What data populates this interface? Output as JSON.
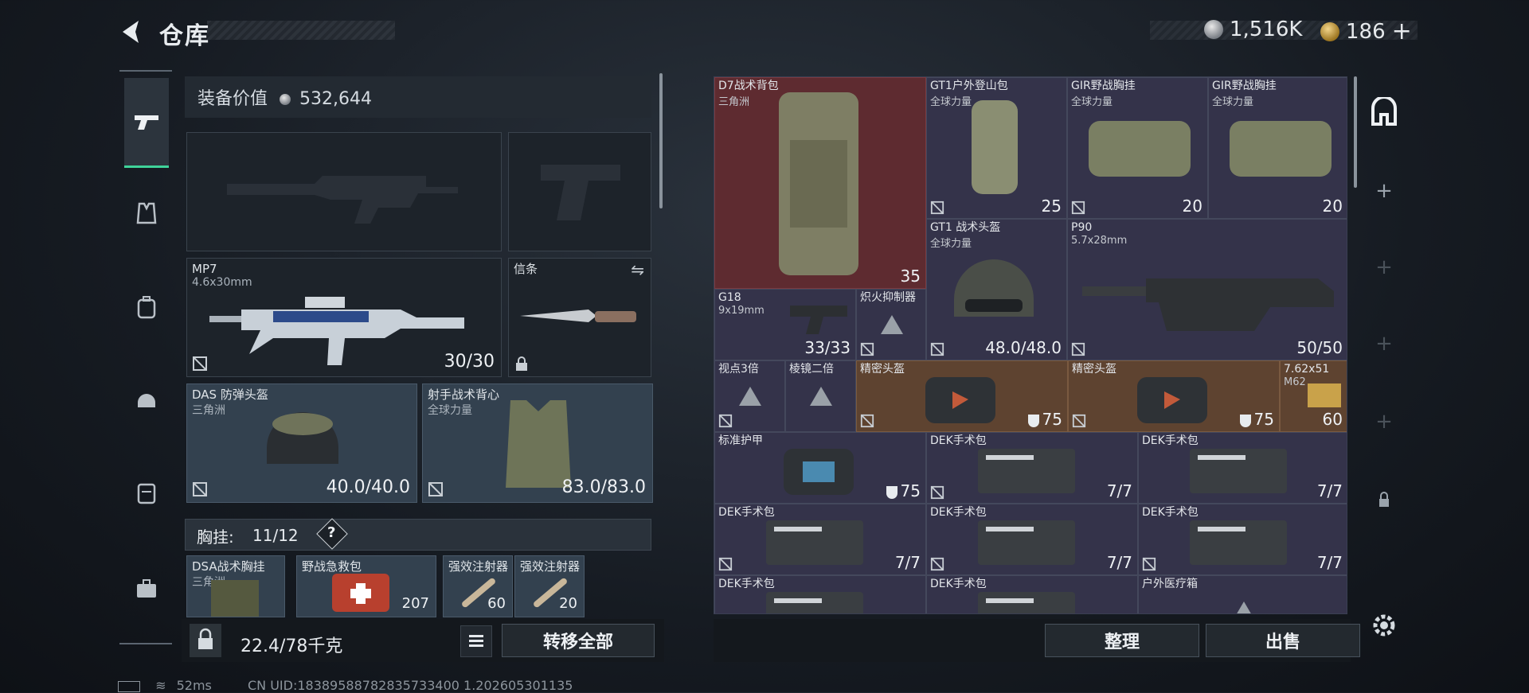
{
  "header": {
    "title": "仓库",
    "currency_silver": "1,516K",
    "currency_gold": "186",
    "add_label": "+"
  },
  "left": {
    "equip_value_label": "装备价值",
    "equip_value": "532,644",
    "slots": {
      "primary": {
        "name": "MP7",
        "sub": "4.6x30mm",
        "count": "30/30"
      },
      "melee": {
        "name": "信条",
        "swap": "⇋"
      },
      "helmet": {
        "name": "DAS 防弹头盔",
        "sub": "三角洲",
        "count": "40.0/40.0"
      },
      "armor": {
        "name": "射手战术背心",
        "sub": "全球力量",
        "count": "83.0/83.0"
      }
    },
    "vest_label": "胸挂:",
    "vest_count": "11/12",
    "vest_help": "?",
    "vest_items": [
      {
        "name": "DSA战术胸挂",
        "sub": "三角洲"
      },
      {
        "name": "野战急救包",
        "count": "207"
      },
      {
        "name": "强效注射器",
        "count": "60"
      },
      {
        "name": "强效注射器",
        "count": "20"
      }
    ],
    "weight": "22.4/78千克",
    "transfer_all": "转移全部"
  },
  "grid": {
    "items": [
      {
        "name": "D7战术背包",
        "sub": "三角洲",
        "count": "35"
      },
      {
        "name": "GT1户外登山包",
        "sub": "全球力量",
        "count": "25"
      },
      {
        "name": "GIR野战胸挂",
        "sub": "全球力量",
        "count": "20"
      },
      {
        "name": "GIR野战胸挂",
        "sub": "全球力量",
        "count": "20"
      },
      {
        "name": "GT1 战术头盔",
        "sub": "全球力量",
        "count": "48.0/48.0"
      },
      {
        "name": "P90",
        "sub": "5.7x28mm",
        "count": "50/50"
      },
      {
        "name": "G18",
        "sub": "9x19mm",
        "count": "33/33"
      },
      {
        "name": "炽火抑制器"
      },
      {
        "name": "视点3倍"
      },
      {
        "name": "棱镜二倍"
      },
      {
        "name": "精密头盔",
        "count": "75"
      },
      {
        "name": "精密头盔",
        "count": "75"
      },
      {
        "name": "7.62x51",
        "sub": "M62",
        "count": "60"
      },
      {
        "name": "标准护甲",
        "count": "75"
      },
      {
        "name": "DEK手术包",
        "count": "7/7"
      },
      {
        "name": "DEK手术包",
        "count": "7/7"
      },
      {
        "name": "DEK手术包",
        "count": "7/7"
      },
      {
        "name": "DEK手术包",
        "count": "7/7"
      },
      {
        "name": "DEK手术包",
        "count": "7/7"
      },
      {
        "name": "DEK手术包"
      },
      {
        "name": "DEK手术包"
      },
      {
        "name": "户外医疗箱"
      }
    ],
    "sort_label": "整理",
    "sell_label": "出售"
  },
  "right_nav": {
    "plus": "+"
  },
  "status": {
    "ping": "52ms",
    "uid": "CN UID:18389588782835733400 1.202605301135"
  },
  "colors": {
    "accent": "#3fd39a",
    "backpack_red": "#5e2b30",
    "rare_orange": "#5e4330",
    "grid_purple": "#2d2e42"
  }
}
